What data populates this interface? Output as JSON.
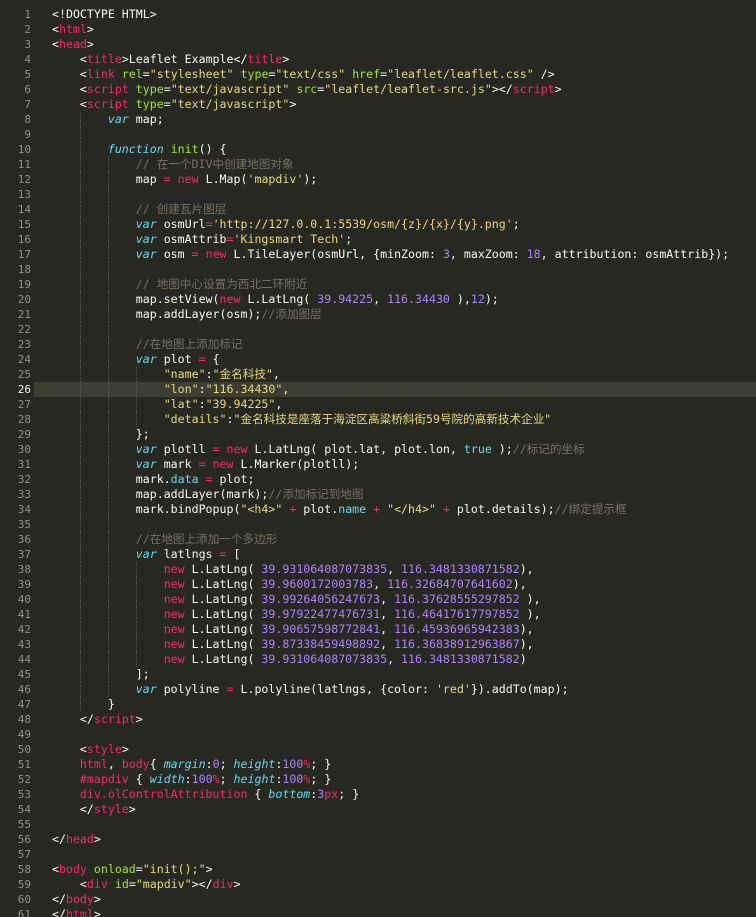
{
  "editor": {
    "current_line": 26,
    "lines": [
      [
        [
          "plain",
          "<!DOCTYPE HTML>"
        ]
      ],
      [
        [
          "plain",
          "<"
        ],
        [
          "tag",
          "html"
        ],
        [
          "plain",
          ">"
        ]
      ],
      [
        [
          "plain",
          "<"
        ],
        [
          "tag",
          "head"
        ],
        [
          "plain",
          ">"
        ]
      ],
      [
        [
          "plain",
          "    <"
        ],
        [
          "tag",
          "title"
        ],
        [
          "plain",
          ">Leaflet Example</"
        ],
        [
          "tag",
          "title"
        ],
        [
          "plain",
          ">"
        ]
      ],
      [
        [
          "plain",
          "    <"
        ],
        [
          "tag",
          "link"
        ],
        [
          "plain",
          " "
        ],
        [
          "attr",
          "rel"
        ],
        [
          "plain",
          "="
        ],
        [
          "str",
          "\"stylesheet\""
        ],
        [
          "plain",
          " "
        ],
        [
          "attr",
          "type"
        ],
        [
          "plain",
          "="
        ],
        [
          "str",
          "\"text/css\""
        ],
        [
          "plain",
          " "
        ],
        [
          "attr",
          "href"
        ],
        [
          "plain",
          "="
        ],
        [
          "str",
          "\"leaflet/leaflet.css\""
        ],
        [
          "plain",
          " />"
        ]
      ],
      [
        [
          "plain",
          "    <"
        ],
        [
          "tag",
          "script"
        ],
        [
          "plain",
          " "
        ],
        [
          "attr",
          "type"
        ],
        [
          "plain",
          "="
        ],
        [
          "str",
          "\"text/javascript\""
        ],
        [
          "plain",
          " "
        ],
        [
          "attr",
          "src"
        ],
        [
          "plain",
          "="
        ],
        [
          "str",
          "\"leaflet/leaflet-src.js\""
        ],
        [
          "plain",
          "></"
        ],
        [
          "tag",
          "script"
        ],
        [
          "plain",
          ">"
        ]
      ],
      [
        [
          "plain",
          "    <"
        ],
        [
          "tag",
          "script"
        ],
        [
          "plain",
          " "
        ],
        [
          "attr",
          "type"
        ],
        [
          "plain",
          "="
        ],
        [
          "str",
          "\"text/javascript\""
        ],
        [
          "plain",
          ">"
        ]
      ],
      [
        [
          "plain",
          "        "
        ],
        [
          "kw",
          "var"
        ],
        [
          "plain",
          " map;"
        ]
      ],
      [
        [
          "plain",
          ""
        ]
      ],
      [
        [
          "plain",
          "        "
        ],
        [
          "kw",
          "function"
        ],
        [
          "plain",
          " "
        ],
        [
          "fn",
          "init"
        ],
        [
          "plain",
          "() {"
        ]
      ],
      [
        [
          "plain",
          "            "
        ],
        [
          "com",
          "// 在一个DIV中创建地图对象"
        ]
      ],
      [
        [
          "plain",
          "            map "
        ],
        [
          "op",
          "="
        ],
        [
          "plain",
          " "
        ],
        [
          "op",
          "new"
        ],
        [
          "plain",
          " L.Map("
        ],
        [
          "str",
          "'mapdiv'"
        ],
        [
          "plain",
          ");"
        ]
      ],
      [
        [
          "plain",
          ""
        ]
      ],
      [
        [
          "plain",
          "            "
        ],
        [
          "com",
          "// 创建瓦片图层"
        ]
      ],
      [
        [
          "plain",
          "            "
        ],
        [
          "kw",
          "var"
        ],
        [
          "plain",
          " osmUrl"
        ],
        [
          "op",
          "="
        ],
        [
          "str",
          "'http://127.0.0.1:5539/osm/{z}/{x}/{y}.png'"
        ],
        [
          "plain",
          ";"
        ]
      ],
      [
        [
          "plain",
          "            "
        ],
        [
          "kw",
          "var"
        ],
        [
          "plain",
          " osmAttrib"
        ],
        [
          "op",
          "="
        ],
        [
          "str",
          "'Kingsmart Tech'"
        ],
        [
          "plain",
          ";"
        ]
      ],
      [
        [
          "plain",
          "            "
        ],
        [
          "kw",
          "var"
        ],
        [
          "plain",
          " osm "
        ],
        [
          "op",
          "="
        ],
        [
          "plain",
          " "
        ],
        [
          "op",
          "new"
        ],
        [
          "plain",
          " L.TileLayer(osmUrl, {minZoom: "
        ],
        [
          "num",
          "3"
        ],
        [
          "plain",
          ", maxZoom: "
        ],
        [
          "num",
          "18"
        ],
        [
          "plain",
          ", attribution: osmAttrib});"
        ]
      ],
      [
        [
          "plain",
          ""
        ]
      ],
      [
        [
          "plain",
          "            "
        ],
        [
          "com",
          "// 地图中心设置为西北二环附近"
        ]
      ],
      [
        [
          "plain",
          "            map.setView("
        ],
        [
          "op",
          "new"
        ],
        [
          "plain",
          " L.LatLng( "
        ],
        [
          "num",
          "39.94225"
        ],
        [
          "plain",
          ", "
        ],
        [
          "num",
          "116.34430"
        ],
        [
          "plain",
          " ),"
        ],
        [
          "num",
          "12"
        ],
        [
          "plain",
          ");"
        ]
      ],
      [
        [
          "plain",
          "            map.addLayer(osm);"
        ],
        [
          "com",
          "//添加图层"
        ]
      ],
      [
        [
          "plain",
          ""
        ]
      ],
      [
        [
          "plain",
          "            "
        ],
        [
          "com",
          "//在地图上添加标记"
        ]
      ],
      [
        [
          "plain",
          "            "
        ],
        [
          "kw",
          "var"
        ],
        [
          "plain",
          " plot "
        ],
        [
          "op",
          "="
        ],
        [
          "plain",
          " {"
        ]
      ],
      [
        [
          "plain",
          "                "
        ],
        [
          "str",
          "\"name\""
        ],
        [
          "plain",
          ":"
        ],
        [
          "str",
          "\"金名科技\""
        ],
        [
          "plain",
          ","
        ]
      ],
      [
        [
          "plain",
          "                "
        ],
        [
          "str",
          "\"lon\""
        ],
        [
          "plain",
          ":"
        ],
        [
          "str",
          "\"116.34430\""
        ],
        [
          "plain",
          ","
        ]
      ],
      [
        [
          "plain",
          "                "
        ],
        [
          "str",
          "\"lat\""
        ],
        [
          "plain",
          ":"
        ],
        [
          "str",
          "\"39.94225\""
        ],
        [
          "plain",
          ","
        ]
      ],
      [
        [
          "plain",
          "                "
        ],
        [
          "str",
          "\"details\""
        ],
        [
          "plain",
          ":"
        ],
        [
          "str",
          "\"金名科技是座落于海淀区高粱桥斜街59号院的高新技术企业\""
        ]
      ],
      [
        [
          "plain",
          "            };"
        ]
      ],
      [
        [
          "plain",
          "            "
        ],
        [
          "kw",
          "var"
        ],
        [
          "plain",
          " plotll "
        ],
        [
          "op",
          "="
        ],
        [
          "plain",
          " "
        ],
        [
          "op",
          "new"
        ],
        [
          "plain",
          " L.LatLng( plot.lat, plot.lon, "
        ],
        [
          "kwn",
          "true"
        ],
        [
          "plain",
          " );"
        ],
        [
          "com",
          "//标记的坐标"
        ]
      ],
      [
        [
          "plain",
          "            "
        ],
        [
          "kw",
          "var"
        ],
        [
          "plain",
          " mark "
        ],
        [
          "op",
          "="
        ],
        [
          "plain",
          " "
        ],
        [
          "op",
          "new"
        ],
        [
          "plain",
          " L.Marker(plotll);"
        ]
      ],
      [
        [
          "plain",
          "            mark."
        ],
        [
          "prop",
          "data"
        ],
        [
          "plain",
          " "
        ],
        [
          "op",
          "="
        ],
        [
          "plain",
          " plot;"
        ]
      ],
      [
        [
          "plain",
          "            map.addLayer(mark);"
        ],
        [
          "com",
          "//添加标记到地图"
        ]
      ],
      [
        [
          "plain",
          "            mark.bindPopup("
        ],
        [
          "str",
          "\"<h4>\""
        ],
        [
          "plain",
          " "
        ],
        [
          "op",
          "+"
        ],
        [
          "plain",
          " plot."
        ],
        [
          "prop",
          "name"
        ],
        [
          "plain",
          " "
        ],
        [
          "op",
          "+"
        ],
        [
          "plain",
          " "
        ],
        [
          "str",
          "\"</h4>\""
        ],
        [
          "plain",
          " "
        ],
        [
          "op",
          "+"
        ],
        [
          "plain",
          " plot.details);"
        ],
        [
          "com",
          "//绑定提示框"
        ]
      ],
      [
        [
          "plain",
          ""
        ]
      ],
      [
        [
          "plain",
          "            "
        ],
        [
          "com",
          "//在地图上添加一个多边形"
        ]
      ],
      [
        [
          "plain",
          "            "
        ],
        [
          "kw",
          "var"
        ],
        [
          "plain",
          " latlngs "
        ],
        [
          "op",
          "="
        ],
        [
          "plain",
          " ["
        ]
      ],
      [
        [
          "plain",
          "                "
        ],
        [
          "op",
          "new"
        ],
        [
          "plain",
          " L.LatLng( "
        ],
        [
          "num",
          "39.931064087073835"
        ],
        [
          "plain",
          ", "
        ],
        [
          "num",
          "116.3481330871582"
        ],
        [
          "plain",
          "),"
        ]
      ],
      [
        [
          "plain",
          "                "
        ],
        [
          "op",
          "new"
        ],
        [
          "plain",
          " L.LatLng( "
        ],
        [
          "num",
          "39.9600172003783"
        ],
        [
          "plain",
          ", "
        ],
        [
          "num",
          "116.32684707641602"
        ],
        [
          "plain",
          "),"
        ]
      ],
      [
        [
          "plain",
          "                "
        ],
        [
          "op",
          "new"
        ],
        [
          "plain",
          " L.LatLng( "
        ],
        [
          "num",
          "39.99264056247673"
        ],
        [
          "plain",
          ", "
        ],
        [
          "num",
          "116.37628555297852"
        ],
        [
          "plain",
          " ),"
        ]
      ],
      [
        [
          "plain",
          "                "
        ],
        [
          "op",
          "new"
        ],
        [
          "plain",
          " L.LatLng( "
        ],
        [
          "num",
          "39.97922477476731"
        ],
        [
          "plain",
          ", "
        ],
        [
          "num",
          "116.46417617797852"
        ],
        [
          "plain",
          " ),"
        ]
      ],
      [
        [
          "plain",
          "                "
        ],
        [
          "op",
          "new"
        ],
        [
          "plain",
          " L.LatLng( "
        ],
        [
          "num",
          "39.90657598772841"
        ],
        [
          "plain",
          ", "
        ],
        [
          "num",
          "116.45936965942383"
        ],
        [
          "plain",
          "),"
        ]
      ],
      [
        [
          "plain",
          "                "
        ],
        [
          "op",
          "new"
        ],
        [
          "plain",
          " L.LatLng( "
        ],
        [
          "num",
          "39.87338459498892"
        ],
        [
          "plain",
          ", "
        ],
        [
          "num",
          "116.36838912963867"
        ],
        [
          "plain",
          "),"
        ]
      ],
      [
        [
          "plain",
          "                "
        ],
        [
          "op",
          "new"
        ],
        [
          "plain",
          " L.LatLng( "
        ],
        [
          "num",
          "39.931064087073835"
        ],
        [
          "plain",
          ", "
        ],
        [
          "num",
          "116.3481330871582"
        ],
        [
          "plain",
          ")"
        ]
      ],
      [
        [
          "plain",
          "            ];"
        ]
      ],
      [
        [
          "plain",
          "            "
        ],
        [
          "kw",
          "var"
        ],
        [
          "plain",
          " polyline "
        ],
        [
          "op",
          "="
        ],
        [
          "plain",
          " L.polyline(latlngs, {color: "
        ],
        [
          "str",
          "'red'"
        ],
        [
          "plain",
          "}).addTo(map);"
        ]
      ],
      [
        [
          "plain",
          "        }"
        ]
      ],
      [
        [
          "plain",
          "    </"
        ],
        [
          "tag",
          "script"
        ],
        [
          "plain",
          ">"
        ]
      ],
      [
        [
          "plain",
          ""
        ]
      ],
      [
        [
          "plain",
          "    <"
        ],
        [
          "tag",
          "style"
        ],
        [
          "plain",
          ">"
        ]
      ],
      [
        [
          "plain",
          "    "
        ],
        [
          "sel",
          "html"
        ],
        [
          "plain",
          ", "
        ],
        [
          "sel",
          "body"
        ],
        [
          "plain",
          "{ "
        ],
        [
          "cprop",
          "margin"
        ],
        [
          "plain",
          ":"
        ],
        [
          "num",
          "0"
        ],
        [
          "plain",
          "; "
        ],
        [
          "cprop",
          "height"
        ],
        [
          "plain",
          ":"
        ],
        [
          "num",
          "100"
        ],
        [
          "unit",
          "%"
        ],
        [
          "plain",
          "; }"
        ]
      ],
      [
        [
          "plain",
          "    "
        ],
        [
          "sel",
          "#mapdiv"
        ],
        [
          "plain",
          " { "
        ],
        [
          "cprop",
          "width"
        ],
        [
          "plain",
          ":"
        ],
        [
          "num",
          "100"
        ],
        [
          "unit",
          "%"
        ],
        [
          "plain",
          "; "
        ],
        [
          "cprop",
          "height"
        ],
        [
          "plain",
          ":"
        ],
        [
          "num",
          "100"
        ],
        [
          "unit",
          "%"
        ],
        [
          "plain",
          "; }"
        ]
      ],
      [
        [
          "plain",
          "    "
        ],
        [
          "sel",
          "div.olControlAttribution"
        ],
        [
          "plain",
          " { "
        ],
        [
          "cprop",
          "bottom"
        ],
        [
          "plain",
          ":"
        ],
        [
          "num",
          "3"
        ],
        [
          "unit",
          "px"
        ],
        [
          "plain",
          "; }"
        ]
      ],
      [
        [
          "plain",
          "    </"
        ],
        [
          "tag",
          "style"
        ],
        [
          "plain",
          ">"
        ]
      ],
      [
        [
          "plain",
          ""
        ]
      ],
      [
        [
          "plain",
          "</"
        ],
        [
          "tag",
          "head"
        ],
        [
          "plain",
          ">"
        ]
      ],
      [
        [
          "plain",
          ""
        ]
      ],
      [
        [
          "plain",
          "<"
        ],
        [
          "tag",
          "body"
        ],
        [
          "plain",
          " "
        ],
        [
          "attr",
          "onload"
        ],
        [
          "plain",
          "="
        ],
        [
          "str",
          "\"init();\""
        ],
        [
          "plain",
          ">"
        ]
      ],
      [
        [
          "plain",
          "    <"
        ],
        [
          "tag",
          "div"
        ],
        [
          "plain",
          " "
        ],
        [
          "attr",
          "id"
        ],
        [
          "plain",
          "="
        ],
        [
          "str",
          "\"mapdiv\""
        ],
        [
          "plain",
          "></"
        ],
        [
          "tag",
          "div"
        ],
        [
          "plain",
          ">"
        ]
      ],
      [
        [
          "plain",
          "</"
        ],
        [
          "tag",
          "body"
        ],
        [
          "plain",
          ">"
        ]
      ],
      [
        [
          "plain",
          "</"
        ],
        [
          "tag",
          "html"
        ],
        [
          "plain",
          ">"
        ]
      ]
    ]
  }
}
